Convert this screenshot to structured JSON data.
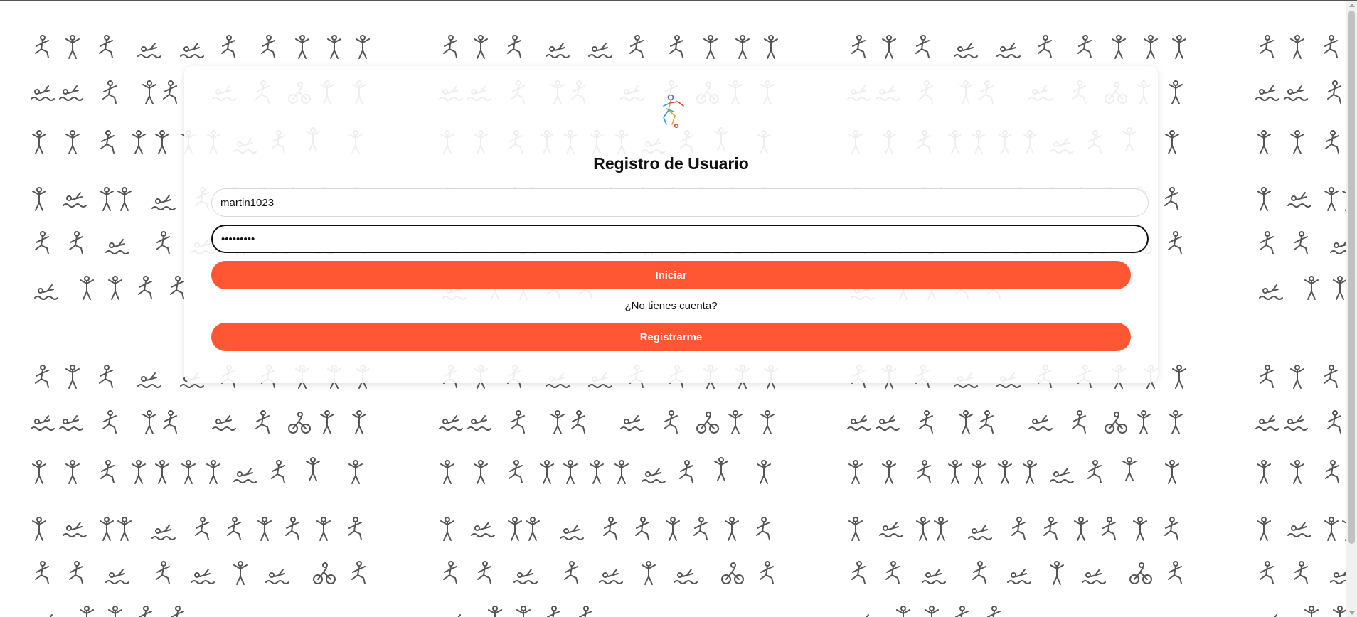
{
  "colors": {
    "accent": "#ff5733",
    "pattern_stroke": "#555555",
    "card_bg": "#ffffff"
  },
  "background": {
    "icon_name": "sports-pictogram-pattern"
  },
  "form": {
    "logo_icon": "athlete-logo-icon",
    "title": "Registro de Usuario",
    "username_value": "martin1023",
    "password_value": "•••••••••",
    "login_label": "Iniciar",
    "no_account_text": "¿No tienes cuenta?",
    "register_label": "Registrarme"
  }
}
